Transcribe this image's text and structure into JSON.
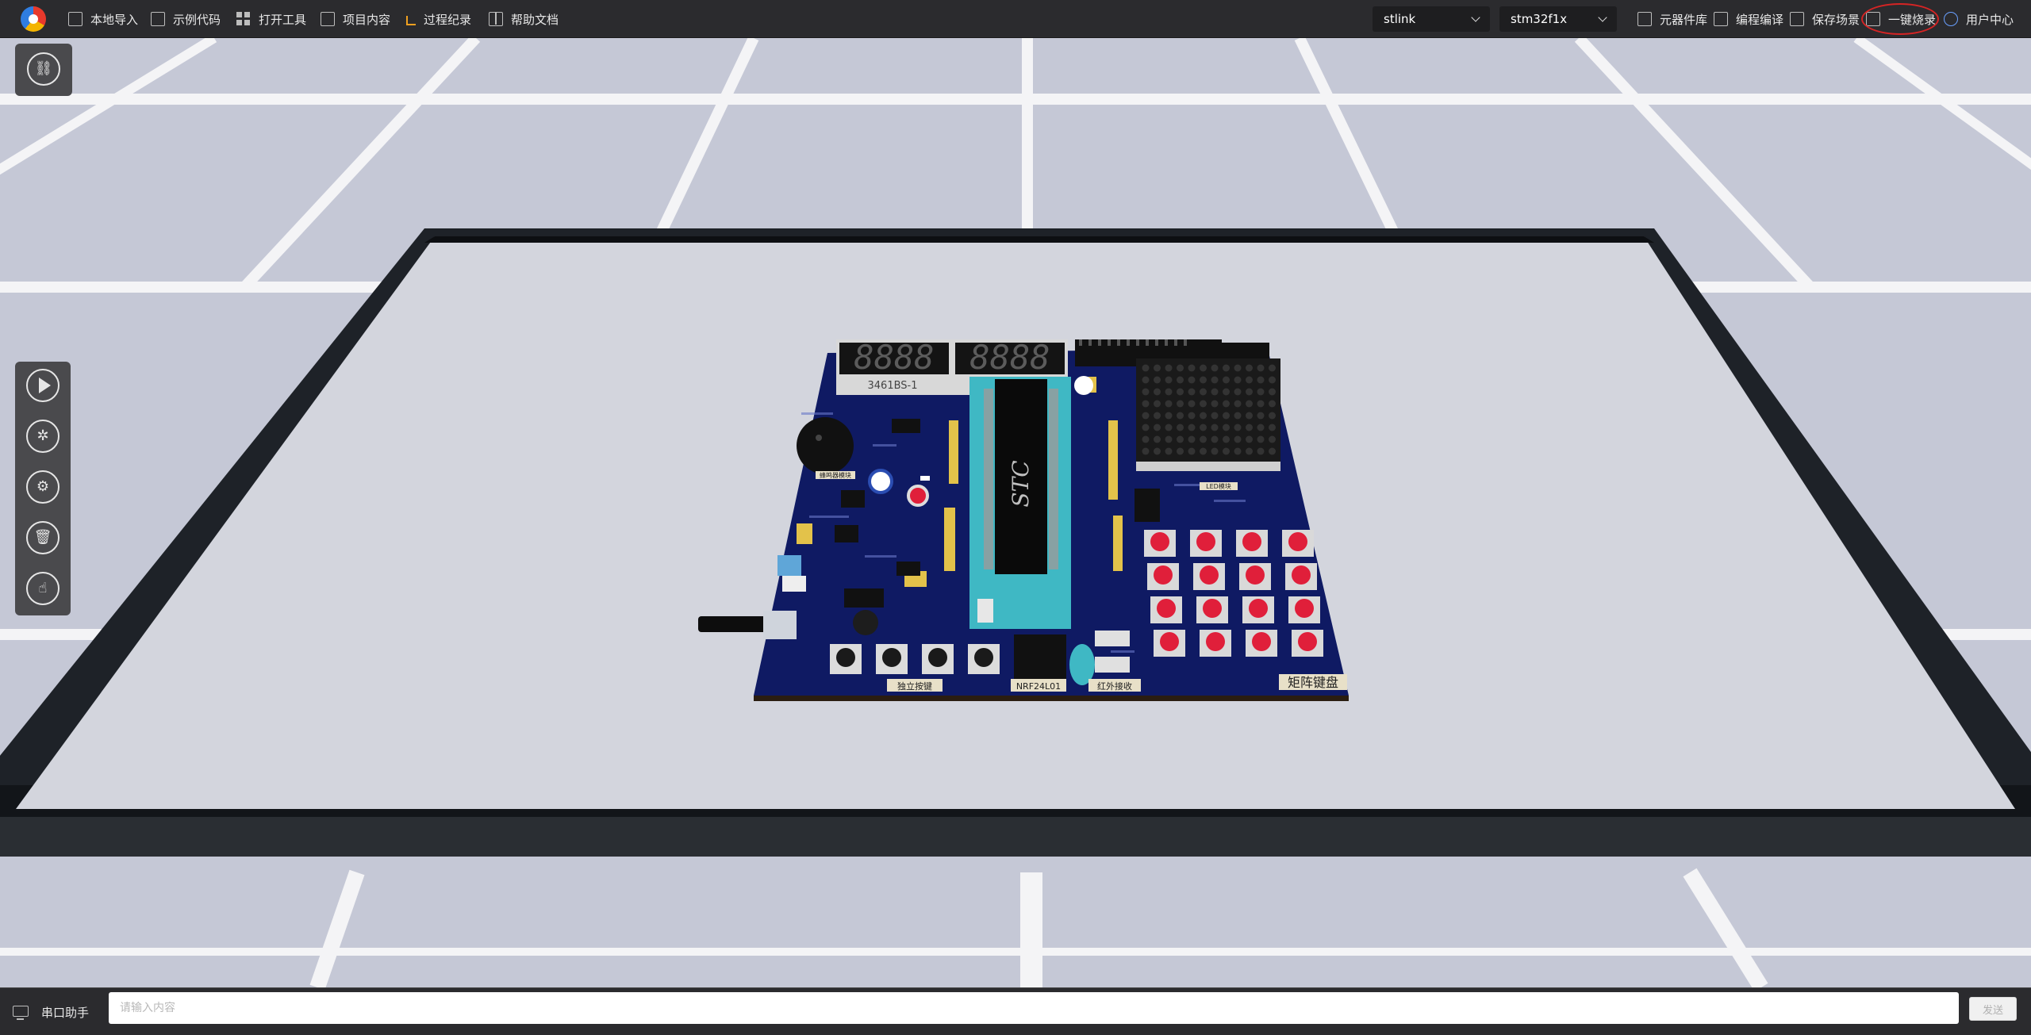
{
  "toolbar": {
    "local_import": "本地导入",
    "example_code": "示例代码",
    "open_tools": "打开工具",
    "project_content": "项目内容",
    "process_record": "过程纪录",
    "help_docs": "帮助文档",
    "debugger_select": "stlink",
    "chip_select": "stm32f1x",
    "component_library": "元器件库",
    "compile": "编程编译",
    "save_scene": "保存场景",
    "one_click_burn": "一键烧录",
    "user_center": "用户中心"
  },
  "board": {
    "seg_display_1": "8888",
    "seg_display_2": "8888",
    "seg_part_label": "3461BS-1",
    "chip_brand": "STC",
    "standalone_keys_label": "独立按键",
    "nrf_label": "NRF24L01",
    "ir_receive_label": "红外接收",
    "matrix_keypad_label": "矩阵键盘",
    "led_module_label": "LED模块",
    "buzzer_label": "蜂鸣器模块"
  },
  "serial": {
    "label": "串口助手",
    "placeholder": "请输入内容",
    "send_label": "发送"
  },
  "colors": {
    "toolbar_bg": "#2b2b2e",
    "pcb_blue": "#0f1a63",
    "key_red": "#e01f3a",
    "socket_cyan": "#3fb8c4",
    "highlight_red": "#d62424"
  },
  "icons": [
    "import-icon",
    "code-icon",
    "tools-grid-icon",
    "project-icon",
    "record-icon",
    "book-icon",
    "chip-icon",
    "compile-icon",
    "save-icon",
    "burn-chip-icon",
    "user-icon",
    "link-icon",
    "play-icon",
    "debug-icon",
    "gear-icon",
    "trash-icon",
    "hand-icon",
    "monitor-icon"
  ]
}
